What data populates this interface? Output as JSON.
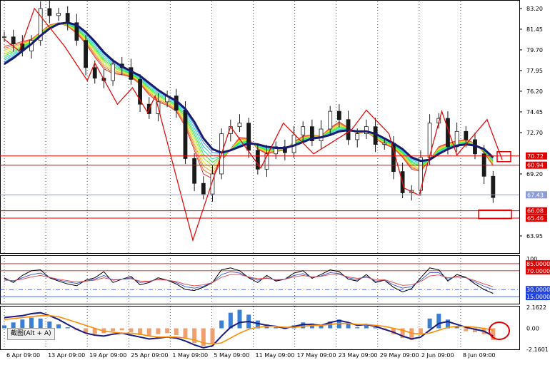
{
  "colors": {
    "candle": "#1a1a1a",
    "ma_fast": "#d01010",
    "ma_slow": "#1a1a6e",
    "zigzag": "#e01010",
    "level_line": "#e00000",
    "current_line": "#8c9cd8",
    "rsi_a": "#000000",
    "rsi_b": "#3050d0",
    "rsi_c": "#e04040",
    "osc_level": "#e00000",
    "osc_low": "#2040e0",
    "hist_pos": "#3b7fd4",
    "hist_neg": "#f0a070",
    "macd_a": "#1a1a80",
    "macd_b": "#ff8c00",
    "grid": "#000000",
    "label_red": "#e00000",
    "label_blue": "#2040e0",
    "label_price": "#8c9cd8"
  },
  "toolbar": {
    "hotkey_label": "截图(Alt + A)"
  },
  "chart_data": [
    {
      "type": "line",
      "panel": "price",
      "ylim": [
        62.5,
        83.8
      ],
      "x": [
        "6 Apr 09:00",
        "13 Apr 09:00",
        "19 Apr 09:00",
        "25 Apr 09:00",
        "1 May 09:00",
        "5 May 09:00",
        "11 May 09:00",
        "17 May 09:00",
        "23 May 09:00",
        "29 May 09:00",
        "2 Jun 09:00",
        "8 Jun 09:00"
      ],
      "y_ticks": [
        "83.20",
        "81.45",
        "79.70",
        "77.95",
        "76.20",
        "74.45",
        "72.70",
        "69.20",
        "63.95"
      ],
      "series": [
        {
          "values": [
            80.8,
            80.2,
            79.6,
            80.5,
            83.2,
            82.6,
            82.8,
            82.0,
            80.5,
            78.2,
            77.3,
            77.1,
            78.5,
            78.2,
            77.2,
            75.1,
            74.3,
            75.3,
            75.8,
            74.6,
            70.5,
            68.4,
            67.5,
            69.2,
            72.6,
            73.2,
            73.5,
            71.2,
            69.6,
            70.9,
            71.5,
            71.0,
            72.5,
            73.2,
            72.0,
            73.0,
            74.5,
            73.8,
            72.1,
            72.6,
            73.2,
            71.7,
            71.8,
            69.4,
            67.6,
            67.8,
            70.6,
            73.5,
            73.9,
            71.5,
            72.8,
            72.1,
            70.9,
            69.0,
            67.2
          ]
        },
        {
          "values": [
            80.0,
            80.2,
            80.4,
            80.6,
            81.2,
            81.8,
            82.0,
            81.7,
            81.1,
            80.2,
            79.1,
            78.1,
            77.7,
            77.6,
            77.4,
            76.8,
            75.9,
            75.3,
            75.0,
            74.5,
            73.2,
            71.2,
            69.2,
            68.8,
            70.3,
            71.3,
            72.3,
            72.2,
            71.3,
            70.9,
            71.1,
            71.2,
            71.9,
            72.4,
            72.5,
            72.4,
            73.1,
            73.6,
            73.1,
            72.6,
            72.8,
            72.2,
            71.7,
            71.4,
            70.6,
            69.6,
            69.4,
            70.4,
            71.5,
            71.8,
            72.0,
            72.1,
            71.8,
            71.0,
            69.9
          ]
        },
        {
          "values": [
            78.5,
            79.0,
            79.6,
            80.2,
            80.9,
            81.5,
            81.9,
            82.0,
            81.8,
            81.2,
            80.4,
            79.5,
            78.8,
            78.3,
            77.9,
            77.5,
            76.9,
            76.3,
            75.8,
            75.4,
            74.7,
            73.6,
            72.2,
            71.3,
            71.0,
            71.2,
            71.5,
            71.8,
            71.7,
            71.5,
            71.4,
            71.4,
            71.6,
            71.9,
            72.2,
            72.3,
            72.5,
            72.8,
            72.9,
            72.8,
            72.8,
            72.6,
            72.2,
            71.8,
            71.3,
            70.6,
            70.3,
            70.4,
            70.9,
            71.3,
            71.6,
            71.7,
            71.6,
            71.3,
            70.6
          ]
        }
      ],
      "zigzag": [
        [
          0,
          80.6
        ],
        [
          2,
          79.6
        ],
        [
          4,
          83.2
        ],
        [
          8,
          80.0
        ],
        [
          11,
          77.1
        ],
        [
          12,
          78.6
        ],
        [
          15,
          75.1
        ],
        [
          17,
          76.5
        ],
        [
          19,
          74.4
        ],
        [
          20,
          75.8
        ],
        [
          25,
          63.6
        ],
        [
          30,
          73.2
        ],
        [
          34,
          69.7
        ],
        [
          37,
          73.5
        ],
        [
          41,
          70.9
        ],
        [
          46,
          72.9
        ],
        [
          48,
          74.6
        ],
        [
          51,
          72.6
        ],
        [
          53,
          68.0
        ],
        [
          55,
          67.4
        ],
        [
          58,
          74.5
        ],
        [
          60,
          70.8
        ],
        [
          64,
          73.8
        ],
        [
          66,
          70.4
        ]
      ],
      "levels": [
        {
          "label": "70.72",
          "value": 70.72,
          "color": "red"
        },
        {
          "label": "60.94",
          "value": 69.94,
          "color": "red"
        },
        {
          "label": "67.43",
          "value": 67.43,
          "color": "price"
        },
        {
          "label": "66.08",
          "value": 66.08,
          "color": "red"
        },
        {
          "label": "65.46",
          "value": 65.46,
          "color": "red"
        }
      ]
    },
    {
      "type": "line",
      "panel": "rsi",
      "ylim": [
        0,
        100
      ],
      "y_ticks": [
        "100",
        "85.0000",
        "70.0000",
        "30.0000",
        "15.0000"
      ],
      "levels": [
        85,
        70,
        30,
        15
      ],
      "series": [
        {
          "values": [
            55,
            45,
            60,
            70,
            72,
            55,
            48,
            42,
            38,
            50,
            55,
            68,
            45,
            52,
            58,
            40,
            45,
            55,
            50,
            42,
            30,
            28,
            35,
            45,
            72,
            76,
            70,
            55,
            45,
            60,
            48,
            52,
            65,
            70,
            54,
            62,
            72,
            68,
            52,
            48,
            62,
            45,
            50,
            35,
            25,
            32,
            55,
            76,
            72,
            48,
            62,
            56,
            42,
            30,
            22
          ]
        },
        {
          "values": [
            52,
            48,
            55,
            62,
            65,
            56,
            50,
            46,
            43,
            48,
            52,
            60,
            50,
            52,
            55,
            45,
            47,
            52,
            50,
            45,
            36,
            33,
            37,
            45,
            62,
            68,
            65,
            56,
            50,
            55,
            50,
            52,
            60,
            64,
            56,
            59,
            66,
            64,
            55,
            51,
            58,
            48,
            50,
            40,
            33,
            36,
            50,
            66,
            66,
            52,
            58,
            55,
            46,
            37,
            30
          ]
        },
        {
          "values": [
            50,
            49,
            52,
            57,
            60,
            56,
            52,
            49,
            46,
            48,
            50,
            55,
            51,
            52,
            53,
            48,
            48,
            51,
            50,
            47,
            41,
            38,
            40,
            45,
            56,
            62,
            62,
            57,
            53,
            54,
            51,
            52,
            57,
            60,
            57,
            58,
            62,
            62,
            57,
            54,
            56,
            51,
            51,
            45,
            39,
            40,
            47,
            59,
            61,
            55,
            57,
            55,
            49,
            42,
            36
          ]
        }
      ]
    },
    {
      "type": "bar",
      "panel": "macd",
      "ylim": [
        -2.1601,
        2.1622
      ],
      "y_ticks": [
        "2.1622",
        "0.00",
        "-2.1601"
      ],
      "histogram": [
        0.3,
        0.6,
        0.9,
        1.1,
        1.0,
        0.7,
        0.4,
        0.1,
        -0.2,
        -0.5,
        -0.6,
        -0.5,
        -0.3,
        -0.2,
        -0.4,
        -0.7,
        -0.8,
        -0.6,
        -0.5,
        -0.7,
        -1.0,
        -1.5,
        -1.8,
        -1.6,
        0.8,
        1.6,
        1.9,
        1.4,
        0.8,
        0.4,
        0.1,
        -0.1,
        0.3,
        0.6,
        0.5,
        0.3,
        0.7,
        0.9,
        0.5,
        0.1,
        0.3,
        0.1,
        -0.2,
        -0.6,
        -1.0,
        -1.2,
        -0.6,
        1.0,
        1.5,
        0.9,
        0.2,
        -0.3,
        -0.4,
        -0.6,
        -1.2
      ],
      "series": [
        {
          "values": [
            1.1,
            1.2,
            1.3,
            1.5,
            1.6,
            1.3,
            0.9,
            0.4,
            -0.1,
            -0.5,
            -0.7,
            -0.8,
            -0.6,
            -0.5,
            -0.7,
            -0.9,
            -1.1,
            -1.0,
            -0.9,
            -1.0,
            -1.3,
            -1.7,
            -2.0,
            -1.8,
            -0.8,
            0.1,
            0.6,
            0.7,
            0.5,
            0.3,
            0.2,
            0.0,
            0.2,
            0.4,
            0.4,
            0.3,
            0.6,
            0.8,
            0.6,
            0.3,
            0.4,
            0.2,
            -0.1,
            -0.4,
            -0.8,
            -1.1,
            -0.9,
            -0.2,
            0.5,
            0.7,
            0.4,
            0.1,
            -0.1,
            -0.3,
            -0.8
          ]
        },
        {
          "values": [
            0.9,
            1.0,
            1.1,
            1.2,
            1.3,
            1.3,
            1.2,
            0.9,
            0.6,
            0.3,
            0.0,
            -0.3,
            -0.4,
            -0.5,
            -0.5,
            -0.6,
            -0.8,
            -0.9,
            -0.9,
            -0.9,
            -1.0,
            -1.2,
            -1.5,
            -1.6,
            -1.5,
            -1.0,
            -0.5,
            -0.1,
            0.1,
            0.2,
            0.2,
            0.1,
            0.1,
            0.2,
            0.3,
            0.3,
            0.4,
            0.5,
            0.5,
            0.4,
            0.4,
            0.3,
            0.2,
            0.0,
            -0.2,
            -0.5,
            -0.6,
            -0.5,
            -0.2,
            0.1,
            0.2,
            0.2,
            0.1,
            0.0,
            -0.2
          ]
        }
      ]
    }
  ]
}
